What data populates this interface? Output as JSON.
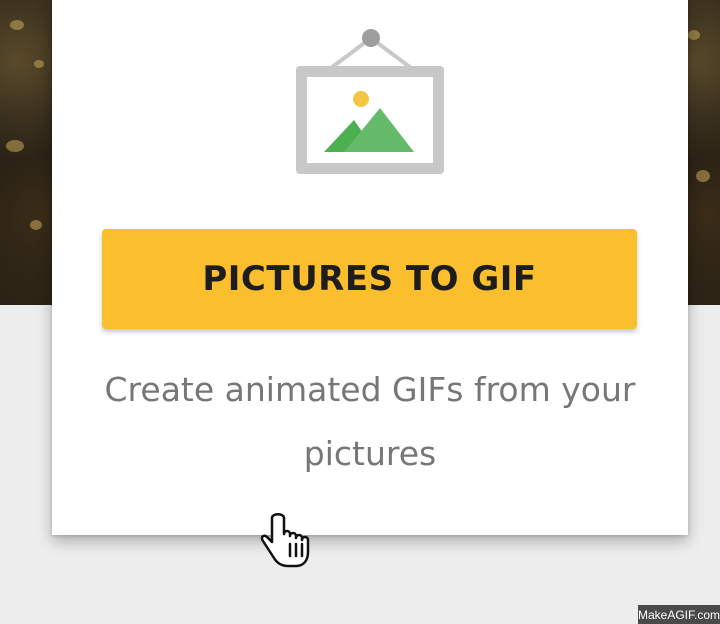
{
  "card": {
    "button_label": "PICTURES TO GIF",
    "description": "Create animated GIFs from your pictures"
  },
  "icons": {
    "frame": "picture-frame-icon",
    "cursor": "hand-pointer-icon"
  },
  "watermark": "MakeAGIF.com",
  "colors": {
    "button": "#fbbf2d",
    "button_text": "#1d1d1d",
    "description_text": "#777777",
    "mountain_dark": "#4caf50",
    "mountain_light": "#66bb6a",
    "sun": "#f4c542",
    "frame": "#c8c8c8"
  }
}
